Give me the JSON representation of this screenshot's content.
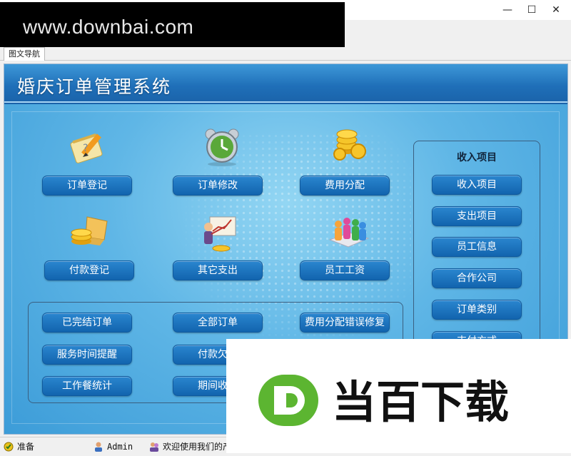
{
  "window": {
    "minimize_glyph": "—",
    "maximize_glyph": "☐",
    "close_glyph": "✕"
  },
  "watermark_top": "www.downbai.com",
  "tab": {
    "label": "图文导航"
  },
  "app": {
    "title": "婚庆订单管理系统"
  },
  "nav_buttons": [
    {
      "label": "订单登记",
      "icon": "notepad-pencil-icon"
    },
    {
      "label": "订单修改",
      "icon": "alarm-clock-icon"
    },
    {
      "label": "费用分配",
      "icon": "gold-coins-icon"
    },
    {
      "label": "付款登记",
      "icon": "laptop-coins-icon"
    },
    {
      "label": "其它支出",
      "icon": "presentation-chart-icon"
    },
    {
      "label": "员工工资",
      "icon": "people-group-icon"
    }
  ],
  "query_buttons": [
    "已完结订单",
    "全部订单",
    "费用分配错误修复",
    "服务时间提醒",
    "付款欠款",
    "工作餐统计",
    "期间收款"
  ],
  "side_panel": {
    "title": "收入项目",
    "items": [
      "收入项目",
      "支出项目",
      "员工信息",
      "合作公司",
      "订单类别",
      "支付方式"
    ]
  },
  "status": {
    "ready": "准备",
    "user": "Admin",
    "welcome": "欢迎使用我们的产"
  },
  "watermark_bottom": {
    "brand": "当百下载",
    "logo_letter": "D"
  },
  "colors": {
    "header": "#1f6fb8",
    "button": "#1a74c0",
    "logo_green": "#5cb531"
  }
}
